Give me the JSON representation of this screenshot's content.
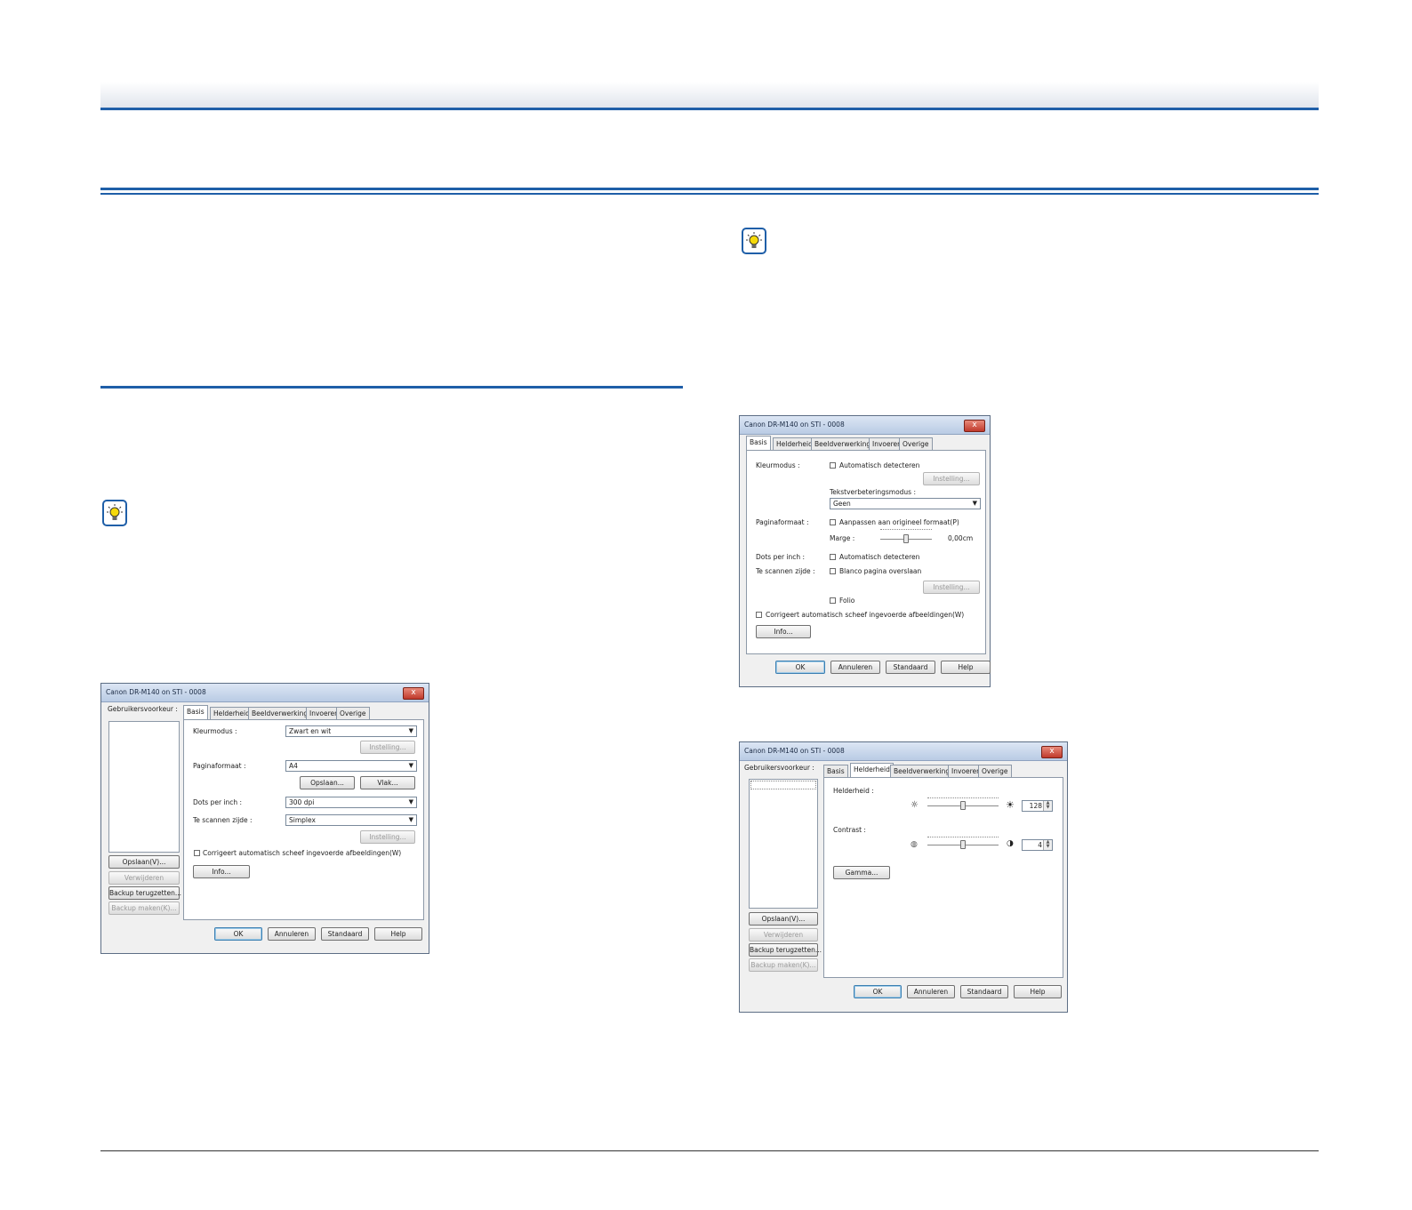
{
  "dialog1": {
    "title": "Canon DR-M140 on STI - 0008",
    "close": "x",
    "presets_label": "Gebruikersvoorkeur :",
    "tabs": [
      "Basis",
      "Helderheid",
      "Beeldverwerking",
      "Invoeren",
      "Overige"
    ],
    "color_mode_label": "Kleurmodus :",
    "color_mode_value": "Zwart en wit",
    "setting_button": "Instelling...",
    "page_size_label": "Paginaformaat :",
    "page_size_value": "A4",
    "save_button": "Opslaan...",
    "area_button": "Vlak...",
    "dpi_label": "Dots per inch :",
    "dpi_value": "300 dpi",
    "side_label": "Te scannen zijde :",
    "side_value": "Simplex",
    "side_setting_button": "Instelling...",
    "deskew_label": "Corrigeert automatisch scheef ingevoerde afbeeldingen(W)",
    "info_button": "Info...",
    "left_buttons": [
      "Opslaan(V)...",
      "Verwijderen",
      "Backup terugzetten...",
      "Backup maken(K)..."
    ],
    "ok": "OK",
    "cancel": "Annuleren",
    "default": "Standaard",
    "help": "Help"
  },
  "dialog2": {
    "title": "Canon DR-M140 on STI - 0008",
    "close": "x",
    "tabs": [
      "Basis",
      "Helderheid",
      "Beeldverwerking",
      "Invoeren",
      "Overige"
    ],
    "color_mode_label": "Kleurmodus :",
    "auto_detect_label": "Automatisch detecteren",
    "setting_button": "Instelling...",
    "text_mode_label": "Tekstverbeteringsmodus :",
    "text_mode_value": "Geen",
    "page_size_label": "Paginaformaat :",
    "fit_label": "Aanpassen aan origineel formaat(P)",
    "margin_label": "Marge :",
    "margin_value": "0,00cm",
    "dpi_label": "Dots per inch :",
    "dpi_auto_label": "Automatisch detecteren",
    "side_label": "Te scannen zijde :",
    "skip_blank_label": "Blanco pagina overslaan",
    "side_setting_button": "Instelling...",
    "folio_label": "Folio",
    "deskew_label": "Corrigeert automatisch scheef ingevoerde afbeeldingen(W)",
    "info_button": "Info...",
    "ok": "OK",
    "cancel": "Annuleren",
    "default": "Standaard",
    "help": "Help"
  },
  "dialog3": {
    "title": "Canon DR-M140 on STI - 0008",
    "close": "x",
    "presets_label": "Gebruikersvoorkeur :",
    "tabs": [
      "Basis",
      "Helderheid",
      "Beeldverwerking",
      "Invoeren",
      "Overige"
    ],
    "brightness_label": "Helderheid :",
    "brightness_value": "128",
    "contrast_label": "Contrast :",
    "contrast_value": "4",
    "gamma_button": "Gamma...",
    "left_buttons": [
      "Opslaan(V)...",
      "Verwijderen",
      "Backup terugzetten...",
      "Backup maken(K)..."
    ],
    "ok": "OK",
    "cancel": "Annuleren",
    "default": "Standaard",
    "help": "Help"
  }
}
